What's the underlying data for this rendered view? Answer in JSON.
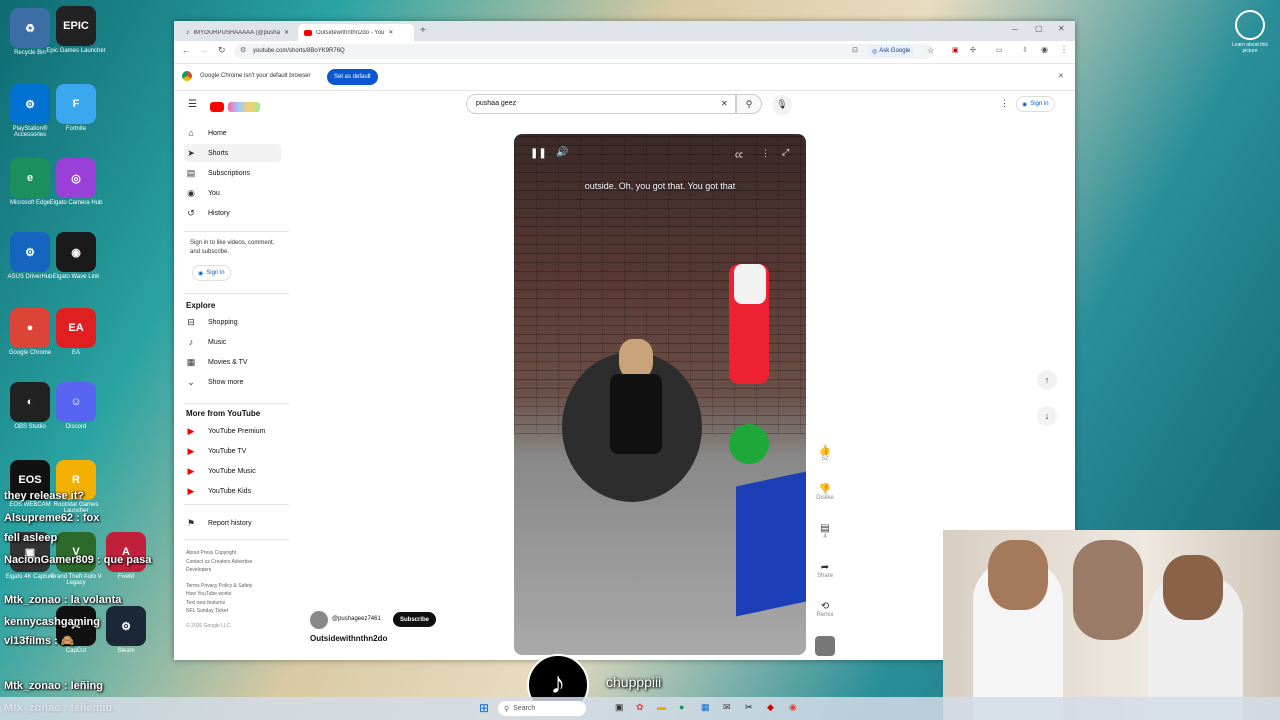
{
  "desktop": {
    "icons": [
      {
        "label": "Recycle Bin",
        "glyph": "♻",
        "color": "#3a6ea5"
      },
      {
        "label": "Epic Games Launcher",
        "glyph": "EPIC",
        "color": "#222"
      },
      {
        "label": "PlayStation® Accessories",
        "glyph": "⚙",
        "color": "#0070d1"
      },
      {
        "label": "Fortnite",
        "glyph": "F",
        "color": "#3aa7ef"
      },
      {
        "label": "Microsoft Edge",
        "glyph": "e",
        "color": "#1b8f5c"
      },
      {
        "label": "Elgato Camera Hub",
        "glyph": "◎",
        "color": "#9b3fd9"
      },
      {
        "label": "ASUS DriverHub",
        "glyph": "⚙",
        "color": "#1565c0"
      },
      {
        "label": "Elgato Wave Link",
        "glyph": "◉",
        "color": "#1a1a1a"
      },
      {
        "label": "Google Chrome",
        "glyph": "●",
        "color": "#db4437"
      },
      {
        "label": "EA",
        "glyph": "EA",
        "color": "#e02020"
      },
      {
        "label": "OBS Studio",
        "glyph": "◐",
        "color": "#222"
      },
      {
        "label": "Discord",
        "glyph": "☺",
        "color": "#5865f2"
      },
      {
        "label": "EOS WEBCAM",
        "glyph": "EOS",
        "color": "#111"
      },
      {
        "label": "Rockstar Games Launcher",
        "glyph": "R",
        "color": "#f4b000"
      },
      {
        "label": "Elgato 4K Capture",
        "glyph": "▣",
        "color": "#333"
      },
      {
        "label": "Grand Theft Auto V Legacy",
        "glyph": "V",
        "color": "#2b6a2b"
      },
      {
        "label": "FiveM",
        "glyph": "A",
        "color": "#c0203a"
      },
      {
        "label": "CapCut",
        "glyph": "✂",
        "color": "#111"
      },
      {
        "label": "Steam",
        "glyph": "⚙",
        "color": "#1b2838"
      }
    ],
    "right_icon_label": "Learn about this picture",
    "chat": [
      {
        "text": "they release it?"
      },
      {
        "text": "Alsupreme62 : fox"
      },
      {
        "text": "fell asleep"
      },
      {
        "text": "NacionGamer809 : que pasa"
      },
      {
        "text": "Mtk_zonao : la volanta"
      },
      {
        "text": "kennycashgaming"
      },
      {
        "text": "vl13films : 🙈"
      },
      {
        "text": "Mtk_zonao : leñing"
      },
      {
        "text": "Mtk_zonao : leñemib"
      }
    ],
    "caption_bottom": "chupppiii"
  },
  "browser": {
    "tabs": [
      {
        "label": "IMYOURPUSHAAAAA (@pusha"
      },
      {
        "label": "Outsidewithnthn2do - You"
      }
    ],
    "url": "youtube.com/shorts/8BoYK9R76Q",
    "ask_google": "Ask Google",
    "infobar_text": "Google Chrome isn't your default browser",
    "infobar_button": "Set as default"
  },
  "youtube": {
    "search_value": "pushaa geez",
    "sign_in": "Sign in",
    "nav": [
      {
        "label": "Home",
        "icon": "home-icon"
      },
      {
        "label": "Shorts",
        "icon": "shorts-icon"
      },
      {
        "label": "Subscriptions",
        "icon": "subscriptions-icon"
      },
      {
        "label": "You",
        "icon": "you-icon"
      },
      {
        "label": "History",
        "icon": "history-icon"
      }
    ],
    "signin_prompt": "Sign in to like videos, comment, and subscribe.",
    "signin_button": "Sign in",
    "explore_title": "Explore",
    "explore": [
      {
        "label": "Shopping"
      },
      {
        "label": "Music"
      },
      {
        "label": "Movies & TV"
      },
      {
        "label": "Show more"
      }
    ],
    "more_title": "More from YouTube",
    "more": [
      {
        "label": "YouTube Premium"
      },
      {
        "label": "YouTube TV"
      },
      {
        "label": "YouTube Music"
      },
      {
        "label": "YouTube Kids"
      }
    ],
    "report_history": "Report history",
    "footer": {
      "line1": "About  Press  Copyright",
      "line2": "Contact us  Creators  Advertise",
      "line3": "Developers",
      "line4": "Terms  Privacy  Policy & Safety",
      "line5": "How YouTube works",
      "line6": "Test new features",
      "line7": "NFL Sunday Ticket",
      "copyright": "© 2026 Google LLC"
    },
    "short": {
      "caption": "outside. Oh, you got that. You got that",
      "channel": "@pushageez7461",
      "subscribe": "Subscribe",
      "title": "Outsidewithnthn2do",
      "likes": "52",
      "dislike": "Dislike",
      "comments": "4",
      "share": "Share",
      "remix": "Remix"
    }
  },
  "taskbar": {
    "search_placeholder": "Search"
  },
  "colors": {
    "accent": "#ff0000",
    "infobar_button": "#0b57d0",
    "subscribe": "#0f0f0f"
  }
}
